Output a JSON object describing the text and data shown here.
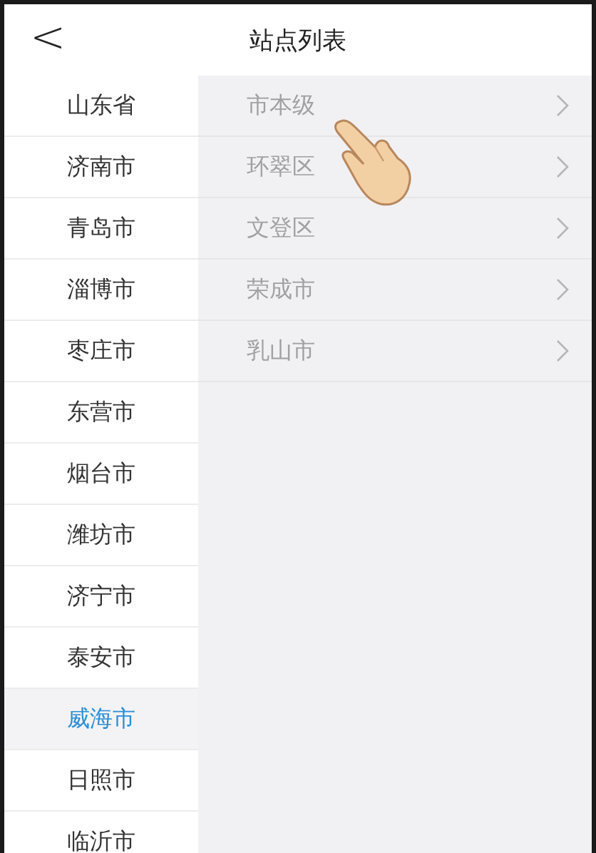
{
  "header": {
    "back": "<",
    "title": "站点列表"
  },
  "provinces": [
    {
      "label": "山东省",
      "selected": false
    },
    {
      "label": "济南市",
      "selected": false
    },
    {
      "label": "青岛市",
      "selected": false
    },
    {
      "label": "淄博市",
      "selected": false
    },
    {
      "label": "枣庄市",
      "selected": false
    },
    {
      "label": "东营市",
      "selected": false
    },
    {
      "label": "烟台市",
      "selected": false
    },
    {
      "label": "潍坊市",
      "selected": false
    },
    {
      "label": "济宁市",
      "selected": false
    },
    {
      "label": "泰安市",
      "selected": false
    },
    {
      "label": "威海市",
      "selected": true
    },
    {
      "label": "日照市",
      "selected": false
    },
    {
      "label": "临沂市",
      "selected": false
    }
  ],
  "districts": [
    {
      "label": "市本级"
    },
    {
      "label": "环翠区"
    },
    {
      "label": "文登区"
    },
    {
      "label": "荣成市"
    },
    {
      "label": "乳山市"
    }
  ]
}
